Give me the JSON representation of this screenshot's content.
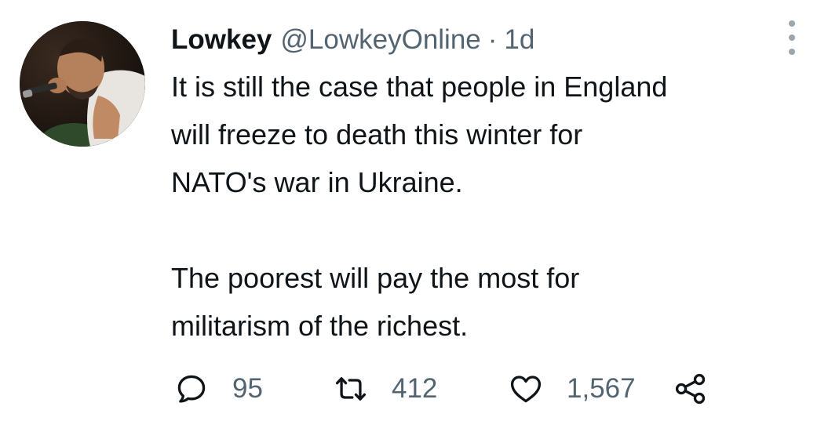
{
  "tweet": {
    "author_name": "Lowkey",
    "handle": "@LowkeyOnline",
    "separator": "·",
    "time": "1d",
    "paragraphs": [
      "It is still the case that people in England\nwill freeze to death this winter for\nNATO's war in Ukraine.",
      "The poorest will pay the most for\nmilitarism of the richest."
    ]
  },
  "actions": {
    "replies": "95",
    "retweets": "412",
    "likes": "1,567"
  },
  "icons": {
    "reply": "reply-icon",
    "retweet": "retweet-icon",
    "like": "heart-icon",
    "share": "share-icon",
    "more": "more-options-icon"
  },
  "colors": {
    "text": "#0f1419",
    "secondary": "#536471"
  }
}
